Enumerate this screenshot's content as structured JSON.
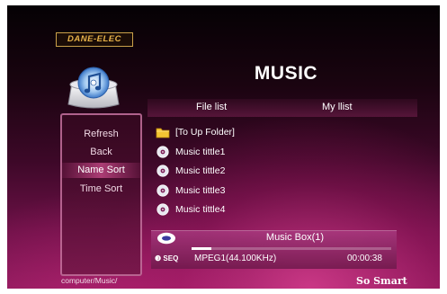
{
  "brand": {
    "logo_text": "DANE-ELEC",
    "slogan": "So Smart"
  },
  "header": {
    "title": "MUSIC"
  },
  "tabs": [
    {
      "label": "File list"
    },
    {
      "label": "My llist"
    }
  ],
  "sidebar": {
    "items": [
      {
        "label": "Refresh"
      },
      {
        "label": "Back"
      },
      {
        "label": "Name Sort",
        "selected": true
      },
      {
        "label": "Time Sort"
      }
    ]
  },
  "files": [
    {
      "label": "[To Up Folder]",
      "icon": "folder-icon"
    },
    {
      "label": "Music tittle1",
      "icon": "audio-file-icon"
    },
    {
      "label": "Music tittle2",
      "icon": "audio-file-icon"
    },
    {
      "label": "Music tittle3",
      "icon": "audio-file-icon"
    },
    {
      "label": "Music tittle4",
      "icon": "audio-file-icon"
    }
  ],
  "player": {
    "track": "Music Box(1)",
    "seq_label": "❸ SEQ",
    "format": "MPEG1(44.100KHz)",
    "time": "00:00:38",
    "progress": 0.1
  },
  "footer": {
    "path": "computer/Music/"
  },
  "colors": {
    "accent": "#c2388a",
    "logo_gold": "#e6b24a"
  }
}
